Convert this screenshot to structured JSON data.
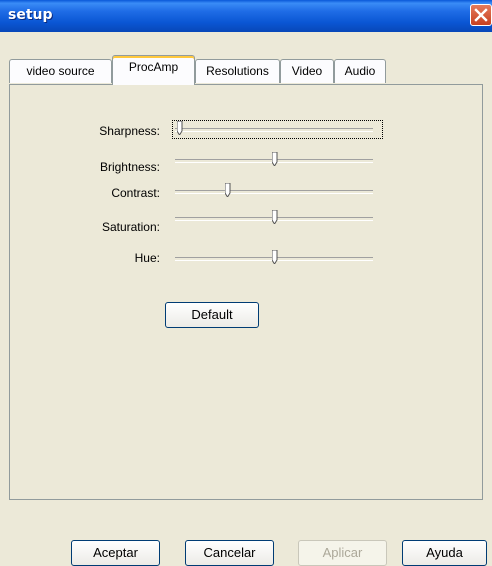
{
  "window": {
    "title": "setup"
  },
  "tabs": [
    {
      "label": "video source",
      "active": false
    },
    {
      "label": "ProcAmp",
      "active": true
    },
    {
      "label": "Resolutions",
      "active": false
    },
    {
      "label": "Video",
      "active": false
    },
    {
      "label": "Audio",
      "active": false
    }
  ],
  "procamp": {
    "sliders": [
      {
        "label": "Sharpness:",
        "value": 0.0
      },
      {
        "label": "Brightness:",
        "value": 0.5
      },
      {
        "label": "Contrast:",
        "value": 0.25
      },
      {
        "label": "Saturation:",
        "value": 0.5
      },
      {
        "label": "Hue:",
        "value": 0.5
      }
    ],
    "default_button": "Default"
  },
  "footer": {
    "ok": "Aceptar",
    "cancel": "Cancelar",
    "apply": "Aplicar",
    "help": "Ayuda"
  },
  "colors": {
    "titlebar": "#0a56d4",
    "dialog_bg": "#ece9d8",
    "close": "#c84020"
  }
}
